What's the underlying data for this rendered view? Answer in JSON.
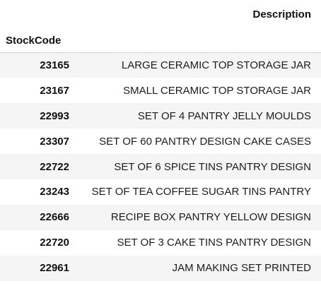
{
  "table": {
    "column_header": "Description",
    "index_name": "StockCode",
    "rows": [
      {
        "code": "23165",
        "description": "LARGE CERAMIC TOP STORAGE JAR"
      },
      {
        "code": "23167",
        "description": "SMALL CERAMIC TOP STORAGE JAR"
      },
      {
        "code": "22993",
        "description": "SET OF 4 PANTRY JELLY MOULDS"
      },
      {
        "code": "23307",
        "description": "SET OF 60 PANTRY DESIGN CAKE CASES"
      },
      {
        "code": "22722",
        "description": "SET OF 6 SPICE TINS PANTRY DESIGN"
      },
      {
        "code": "23243",
        "description": "SET OF TEA COFFEE SUGAR TINS PANTRY"
      },
      {
        "code": "22666",
        "description": "RECIPE BOX PANTRY YELLOW DESIGN"
      },
      {
        "code": "22720",
        "description": "SET OF 3 CAKE TINS PANTRY DESIGN"
      },
      {
        "code": "22961",
        "description": "JAM MAKING SET PRINTED"
      }
    ]
  },
  "colors": {
    "stripe": "#f5f5f5",
    "background": "#ffffff",
    "rule": "#d6d6d6"
  }
}
